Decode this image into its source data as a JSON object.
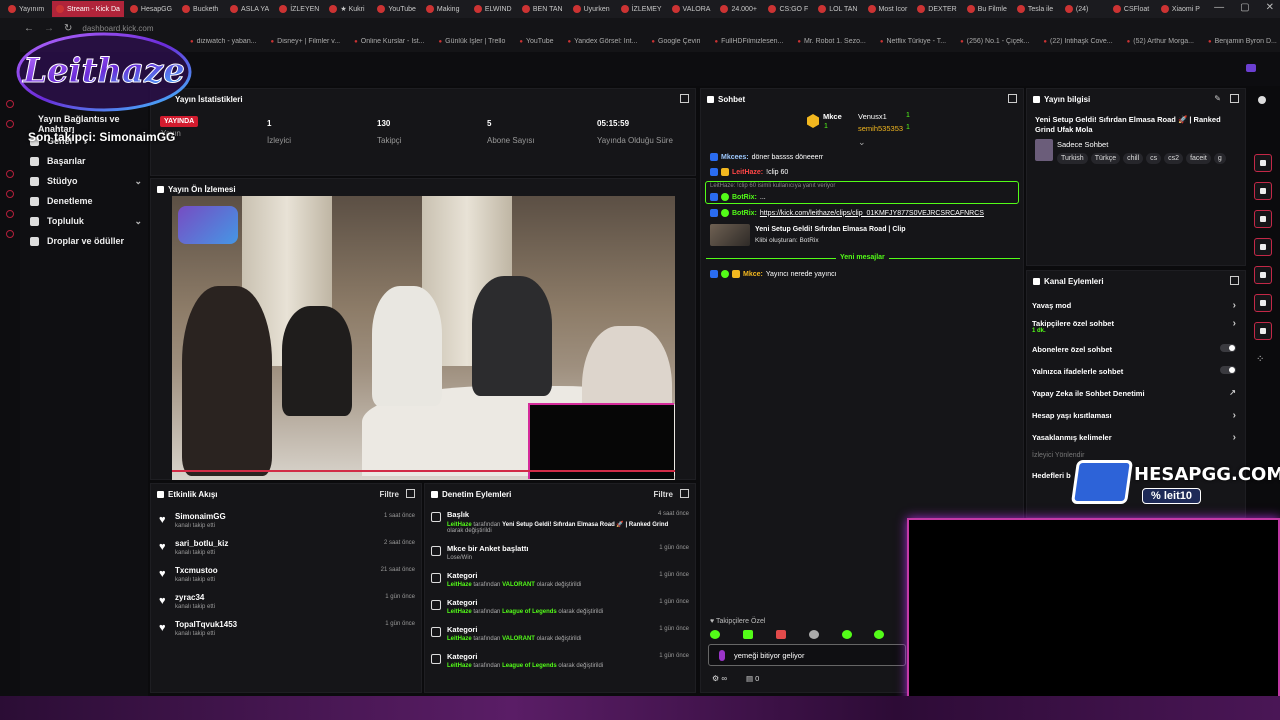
{
  "browser": {
    "tabs": [
      {
        "label": "Yayınım"
      },
      {
        "label": "Stream - Kick Da",
        "active": true
      },
      {
        "label": "HesapGG"
      },
      {
        "label": "Bucketh"
      },
      {
        "label": "ASLA YA"
      },
      {
        "label": "İZLEYEN"
      },
      {
        "label": "★ Kukri"
      },
      {
        "label": "YouTube"
      },
      {
        "label": "Making"
      },
      {
        "label": "ELWIND"
      },
      {
        "label": "BEN TAN"
      },
      {
        "label": "Uyurken"
      },
      {
        "label": "İZLEMEY"
      },
      {
        "label": "VALORA"
      },
      {
        "label": "24.000+"
      },
      {
        "label": "CS:GO F"
      },
      {
        "label": "LOL TAN"
      },
      {
        "label": "Most Icor"
      },
      {
        "label": "DEXTER"
      },
      {
        "label": "Bu Filmle"
      },
      {
        "label": "Tesla ile"
      },
      {
        "label": "(24)"
      },
      {
        "label": "CSFloat"
      },
      {
        "label": "Xiaomi P"
      }
    ],
    "url": "dashboard.kick.com",
    "bookmarks": [
      "diziwatch - yaban...",
      "Disney+ | Filmler v...",
      "Online Kurslar - İst...",
      "Günlük İşler | Trello",
      "YouTube",
      "Yandex Görsel: İnt...",
      "Google Çeviri",
      "FullHDFilmizlesen...",
      "Mr. Robot 1. Sezo...",
      "Netflix Türkiye - T...",
      "(256) No.1 - Çiçek...",
      "(22) İntihaşk Cove...",
      "(52) Arthur Morga...",
      "Benjamin Byron D..."
    ]
  },
  "overlay": {
    "brand_logo": "Leithaze",
    "last_follower": "Son takipçi: SimonaimGG",
    "hesapgg_logo": "HESAPGG.COM",
    "promo_code": "% leit10"
  },
  "sidebar": {
    "items": [
      {
        "label": "Yayın Bağlantısı ve Anahtarı"
      },
      {
        "label": "Genel"
      },
      {
        "label": "Başarılar"
      },
      {
        "label": "Stüdyo"
      },
      {
        "label": "Denetleme"
      },
      {
        "label": "Topluluk"
      },
      {
        "label": "Droplar ve ödüller"
      }
    ]
  },
  "stats": {
    "title": "Yayın İstatistikleri",
    "live_badge": "YAYINDA",
    "duration_label": "Yayın",
    "items": [
      {
        "value": "1",
        "label": "İzleyici"
      },
      {
        "value": "130",
        "label": "Takipçi"
      },
      {
        "value": "5",
        "label": "Abone Sayısı"
      },
      {
        "value": "05:15:59",
        "label": "Yayında Olduğu Süre"
      }
    ]
  },
  "preview": {
    "title": "Yayın Ön İzlemesi"
  },
  "activity": {
    "title": "Etkinlik Akışı",
    "filter": "Filtre",
    "rows": [
      {
        "name": "SimonaimGG",
        "sub": "kanalı takip etti",
        "time": "1 saat önce"
      },
      {
        "name": "sari_botlu_kiz",
        "sub": "kanalı takip etti",
        "time": "2 saat önce"
      },
      {
        "name": "Txcmustoo",
        "sub": "kanalı takip etti",
        "time": "21 saat önce"
      },
      {
        "name": "zyrac34",
        "sub": "kanalı takip etti",
        "time": "1 gün önce"
      },
      {
        "name": "TopalTqvuk1453",
        "sub": "kanalı takip etti",
        "time": "1 gün önce"
      }
    ]
  },
  "moderation": {
    "title": "Denetim Eylemleri",
    "filter": "Filtre",
    "rows": [
      {
        "title": "Başlık",
        "user": "LeitHaze",
        "pre": "tarafından",
        "val": "Yeni Setup Geldi! Sıfırdan Elmasa Road 🚀 | Ranked Grind",
        "post": "olarak değiştirildi",
        "time": "4 saat önce"
      },
      {
        "title": "Mkce bir Anket başlattı",
        "user": "",
        "pre": "",
        "val": "",
        "post": "Lose/Win",
        "time": "1 gün önce"
      },
      {
        "title": "Kategori",
        "user": "LeitHaze",
        "pre": "tarafından",
        "val": "VALORANT",
        "post": "olarak değiştirildi",
        "time": "1 gün önce"
      },
      {
        "title": "Kategori",
        "user": "LeitHaze",
        "pre": "tarafından",
        "val": "League of Legends",
        "post": "olarak değiştirildi",
        "time": "1 gün önce"
      },
      {
        "title": "Kategori",
        "user": "LeitHaze",
        "pre": "tarafından",
        "val": "VALORANT",
        "post": "olarak değiştirildi",
        "time": "1 gün önce"
      },
      {
        "title": "Kategori",
        "user": "LeitHaze",
        "pre": "tarafından",
        "val": "League of Legends",
        "post": "olarak değiştirildi",
        "time": "1 gün önce"
      }
    ]
  },
  "chat": {
    "title": "Sohbet",
    "pinned": {
      "user1": "Mkce",
      "count1": "1",
      "user2": "Venusx1",
      "count2": "1",
      "user3": "semih535353",
      "count3": "1"
    },
    "messages": [
      {
        "user": "Mkcees:",
        "text": "döner bassss döneeerr"
      },
      {
        "user": "LeitHaze:",
        "text": "!clip 60"
      },
      {
        "reply": "LeitHaze: !clip 60 isimli kullanıcıya yanıt veriyor",
        "user": "BotRix:",
        "text": "..."
      },
      {
        "user": "BotRix:",
        "text": "https://kick.com/leithaze/clips/clip_01KMFJY877S0VEJRCSRCAFNRCS"
      },
      {
        "clip_title": "Yeni Setup Geldi! Sıfırdan Elmasa Road | Clip",
        "clip_sub": "Klibi oluşturan: BotRix"
      },
      {
        "user": "Mkce:",
        "text": "Yayıncı nerede yayıncı"
      }
    ],
    "new_messages": "Yeni mesajlar",
    "followers_only": "Takipçilere Özel",
    "input_value": "yemeği bitiyor geliyor",
    "counter": "0"
  },
  "stream_info": {
    "title": "Yayın bilgisi",
    "stream_title": "Yeni Setup Geldi! Sıfırdan Elmasa Road 🚀 | Ranked Grind Ufak Mola",
    "category": "Sadece Sohbet",
    "tags": [
      "Turkish",
      "Türkçe",
      "chill",
      "cs",
      "cs2",
      "faceit",
      "g"
    ]
  },
  "channel_actions": {
    "title": "Kanal Eylemleri",
    "items": [
      {
        "label": "Yavaş mod",
        "control": "chevron"
      },
      {
        "label": "Takipçilere özel sohbet",
        "sub": "1 dk.",
        "control": "chevron"
      },
      {
        "label": "Abonelere özel sohbet",
        "control": "toggle"
      },
      {
        "label": "Yalnızca ifadelerle sohbet",
        "control": "toggle"
      },
      {
        "label": "Yapay Zeka ile Sohbet Denetimi",
        "control": "external"
      },
      {
        "label": "Hesap yaşı kısıtlaması",
        "control": "chevron"
      },
      {
        "label": "Yasaklanmış kelimeler",
        "control": "chevron"
      }
    ],
    "section_label": "İzleyici Yönlendir",
    "goals": "Hedefleri b"
  },
  "colors": {
    "accent": "#53fc18",
    "live": "#d21b2e",
    "brand_pink": "#c43aa6"
  }
}
